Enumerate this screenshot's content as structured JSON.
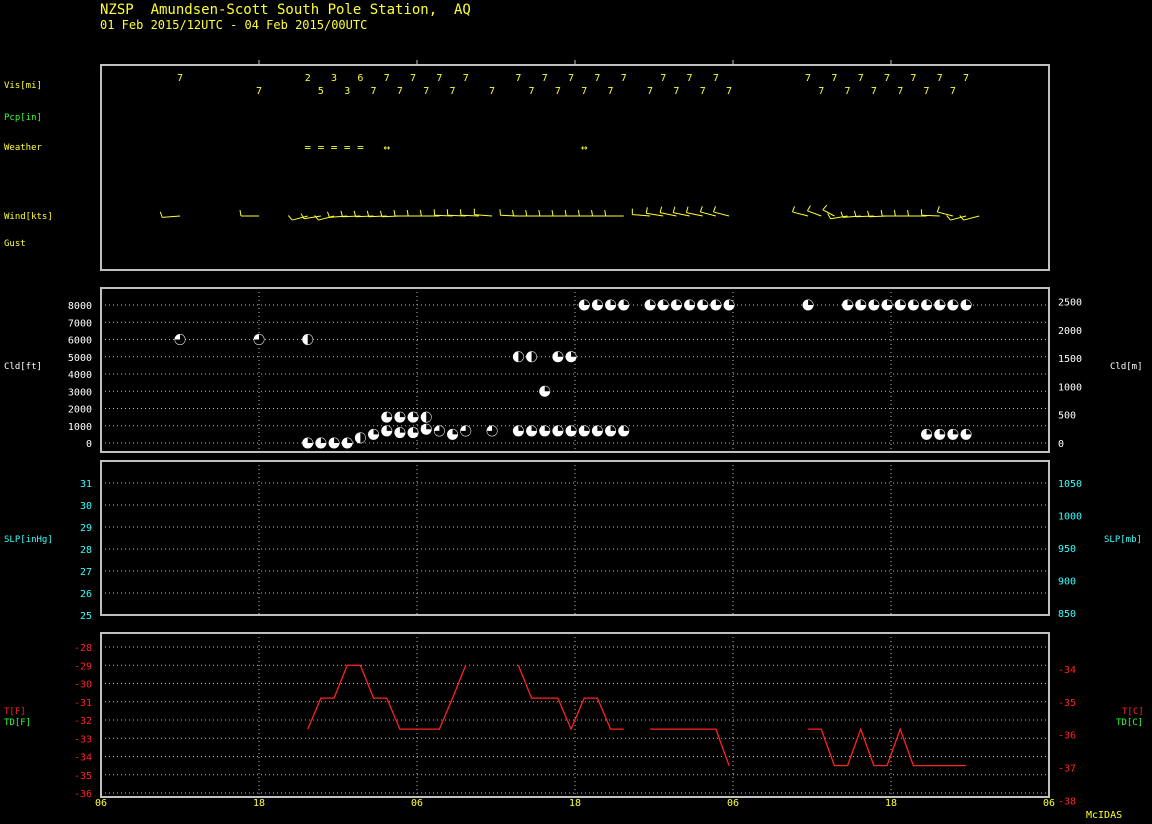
{
  "header": {
    "station_line": "NZSP  Amundsen-Scott South Pole Station,  AQ",
    "period_line": "01 Feb 2015/12UTC - 04 Feb 2015/00UTC"
  },
  "footer": {
    "credit": "McIDAS"
  },
  "colors": {
    "frame": "#c0c0c0",
    "yellow": "#ffff33",
    "green": "#33ff33",
    "cyan": "#33ffff",
    "red": "#ff2222",
    "white": "#ffffff",
    "grid": "#b8b8b8"
  },
  "time_axis": {
    "start_hours": 0,
    "end_hours": 72,
    "tick_hours": [
      0,
      12,
      24,
      36,
      48,
      60,
      72
    ],
    "tick_labels": [
      "06",
      "18",
      "06",
      "18",
      "06",
      "18",
      "06"
    ]
  },
  "weather_panel": {
    "labels": [
      {
        "key": "vis",
        "text": "Vis[mi]",
        "color": "yellow"
      },
      {
        "key": "pcp",
        "text": "Pcp[in]",
        "color": "green"
      },
      {
        "key": "weather",
        "text": "Weather",
        "color": "yellow"
      },
      {
        "key": "wind",
        "text": "Wind[kts]",
        "color": "yellow"
      },
      {
        "key": "gust",
        "text": "Gust",
        "color": "yellow"
      }
    ],
    "visibility": [
      {
        "t": 6,
        "v": "7",
        "row": 0
      },
      {
        "t": 12,
        "v": "7",
        "row": 1
      },
      {
        "t": 15.7,
        "v": "2",
        "row": 0
      },
      {
        "t": 16.7,
        "v": "5",
        "row": 1
      },
      {
        "t": 17.7,
        "v": "3",
        "row": 0
      },
      {
        "t": 18.7,
        "v": "3",
        "row": 1
      },
      {
        "t": 19.7,
        "v": "6",
        "row": 0
      },
      {
        "t": 20.7,
        "v": "7",
        "row": 1
      },
      {
        "t": 21.7,
        "v": "7",
        "row": 0
      },
      {
        "t": 22.7,
        "v": "7",
        "row": 1
      },
      {
        "t": 23.7,
        "v": "7",
        "row": 0
      },
      {
        "t": 24.7,
        "v": "7",
        "row": 1
      },
      {
        "t": 25.7,
        "v": "7",
        "row": 0
      },
      {
        "t": 26.7,
        "v": "7",
        "row": 1
      },
      {
        "t": 27.7,
        "v": "7",
        "row": 0
      },
      {
        "t": 29.7,
        "v": "7",
        "row": 1
      },
      {
        "t": 31.7,
        "v": "7",
        "row": 0
      },
      {
        "t": 32.7,
        "v": "7",
        "row": 1
      },
      {
        "t": 33.7,
        "v": "7",
        "row": 0
      },
      {
        "t": 34.7,
        "v": "7",
        "row": 1
      },
      {
        "t": 35.7,
        "v": "7",
        "row": 0
      },
      {
        "t": 36.7,
        "v": "7",
        "row": 1
      },
      {
        "t": 37.7,
        "v": "7",
        "row": 0
      },
      {
        "t": 38.7,
        "v": "7",
        "row": 1
      },
      {
        "t": 39.7,
        "v": "7",
        "row": 0
      },
      {
        "t": 41.7,
        "v": "7",
        "row": 1
      },
      {
        "t": 42.7,
        "v": "7",
        "row": 0
      },
      {
        "t": 43.7,
        "v": "7",
        "row": 1
      },
      {
        "t": 44.7,
        "v": "7",
        "row": 0
      },
      {
        "t": 45.7,
        "v": "7",
        "row": 1
      },
      {
        "t": 46.7,
        "v": "7",
        "row": 0
      },
      {
        "t": 47.7,
        "v": "7",
        "row": 1
      },
      {
        "t": 53.7,
        "v": "7",
        "row": 0
      },
      {
        "t": 54.7,
        "v": "7",
        "row": 1
      },
      {
        "t": 55.7,
        "v": "7",
        "row": 0
      },
      {
        "t": 56.7,
        "v": "7",
        "row": 1
      },
      {
        "t": 57.7,
        "v": "7",
        "row": 0
      },
      {
        "t": 58.7,
        "v": "7",
        "row": 1
      },
      {
        "t": 59.7,
        "v": "7",
        "row": 0
      },
      {
        "t": 60.7,
        "v": "7",
        "row": 1
      },
      {
        "t": 61.7,
        "v": "7",
        "row": 0
      },
      {
        "t": 62.7,
        "v": "7",
        "row": 1
      },
      {
        "t": 63.7,
        "v": "7",
        "row": 0
      },
      {
        "t": 64.7,
        "v": "7",
        "row": 1
      },
      {
        "t": 65.7,
        "v": "7",
        "row": 0
      }
    ],
    "weather_symbols": [
      {
        "t": 15.7,
        "sym": "="
      },
      {
        "t": 16.7,
        "sym": "="
      },
      {
        "t": 17.7,
        "sym": "="
      },
      {
        "t": 18.7,
        "sym": "="
      },
      {
        "t": 19.7,
        "sym": "="
      },
      {
        "t": 21.7,
        "sym": "↔"
      },
      {
        "t": 36.7,
        "sym": "↔"
      }
    ],
    "wind_barbs": [
      {
        "t": 6,
        "dir": 260,
        "barbs": 1
      },
      {
        "t": 12,
        "dir": 270,
        "barbs": 1
      },
      {
        "t": 15.7,
        "dir": 240,
        "barbs": 1
      },
      {
        "t": 16.7,
        "dir": 250,
        "barbs": 1
      },
      {
        "t": 17.7,
        "dir": 240,
        "barbs": 1
      },
      {
        "t": 18.7,
        "dir": 260,
        "barbs": 1
      },
      {
        "t": 19.7,
        "dir": 265,
        "barbs": 1
      },
      {
        "t": 20.7,
        "dir": 265,
        "barbs": 1
      },
      {
        "t": 21.7,
        "dir": 265,
        "barbs": 1
      },
      {
        "t": 22.7,
        "dir": 265,
        "barbs": 1
      },
      {
        "t": 23.7,
        "dir": 270,
        "barbs": 1
      },
      {
        "t": 24.7,
        "dir": 270,
        "barbs": 1
      },
      {
        "t": 25.7,
        "dir": 270,
        "barbs": 1
      },
      {
        "t": 26.7,
        "dir": 275,
        "barbs": 1
      },
      {
        "t": 27.7,
        "dir": 275,
        "barbs": 1
      },
      {
        "t": 28.7,
        "dir": 275,
        "barbs": 1
      },
      {
        "t": 29.7,
        "dir": 280,
        "barbs": 1
      },
      {
        "t": 31.7,
        "dir": 275,
        "barbs": 1
      },
      {
        "t": 32.7,
        "dir": 270,
        "barbs": 1
      },
      {
        "t": 33.7,
        "dir": 270,
        "barbs": 1
      },
      {
        "t": 34.7,
        "dir": 270,
        "barbs": 1
      },
      {
        "t": 35.7,
        "dir": 270,
        "barbs": 1
      },
      {
        "t": 36.7,
        "dir": 270,
        "barbs": 1
      },
      {
        "t": 37.7,
        "dir": 270,
        "barbs": 1
      },
      {
        "t": 38.7,
        "dir": 270,
        "barbs": 1
      },
      {
        "t": 39.7,
        "dir": 270,
        "barbs": 1
      },
      {
        "t": 41.7,
        "dir": 280,
        "barbs": 1
      },
      {
        "t": 42.7,
        "dir": 290,
        "barbs": 1
      },
      {
        "t": 43.7,
        "dir": 295,
        "barbs": 1
      },
      {
        "t": 44.7,
        "dir": 295,
        "barbs": 1
      },
      {
        "t": 45.7,
        "dir": 295,
        "barbs": 1
      },
      {
        "t": 46.7,
        "dir": 300,
        "barbs": 1
      },
      {
        "t": 47.7,
        "dir": 300,
        "barbs": 1
      },
      {
        "t": 53.7,
        "dir": 300,
        "barbs": 1
      },
      {
        "t": 54.7,
        "dir": 310,
        "barbs": 1
      },
      {
        "t": 55.7,
        "dir": 320,
        "barbs": 1
      },
      {
        "t": 56.7,
        "dir": 250,
        "barbs": 1
      },
      {
        "t": 57.7,
        "dir": 260,
        "barbs": 1
      },
      {
        "t": 58.7,
        "dir": 265,
        "barbs": 1
      },
      {
        "t": 59.7,
        "dir": 265,
        "barbs": 1
      },
      {
        "t": 60.7,
        "dir": 270,
        "barbs": 1
      },
      {
        "t": 61.7,
        "dir": 270,
        "barbs": 1
      },
      {
        "t": 62.7,
        "dir": 270,
        "barbs": 1
      },
      {
        "t": 63.7,
        "dir": 275,
        "barbs": 1
      },
      {
        "t": 64.7,
        "dir": 300,
        "barbs": 1
      },
      {
        "t": 65.7,
        "dir": 240,
        "barbs": 1
      },
      {
        "t": 66.7,
        "dir": 240,
        "barbs": 1
      }
    ]
  },
  "chart_data": [
    {
      "type": "scatter",
      "panel": "cloud",
      "ylabel_left": "Cld[ft]",
      "ylabel_right": "Cld[m]",
      "ylim": [
        0,
        8500
      ],
      "left_ticks": [
        0,
        1000,
        2000,
        3000,
        4000,
        5000,
        6000,
        7000,
        8000
      ],
      "right_ticks_m": [
        0,
        500,
        1000,
        1500,
        2000,
        2500
      ],
      "points": [
        {
          "t": 6,
          "ft": 6000,
          "cover": "bkn"
        },
        {
          "t": 12,
          "ft": 6000,
          "cover": "bkn"
        },
        {
          "t": 15.7,
          "ft": 6000,
          "cover": "sct"
        },
        {
          "t": 15.7,
          "ft": 0,
          "cover": "few"
        },
        {
          "t": 16.7,
          "ft": 0,
          "cover": "few"
        },
        {
          "t": 17.7,
          "ft": 0,
          "cover": "few"
        },
        {
          "t": 18.7,
          "ft": 0,
          "cover": "few"
        },
        {
          "t": 19.7,
          "ft": 300,
          "cover": "sct"
        },
        {
          "t": 20.7,
          "ft": 500,
          "cover": "few"
        },
        {
          "t": 21.7,
          "ft": 700,
          "cover": "few"
        },
        {
          "t": 21.7,
          "ft": 1500,
          "cover": "few"
        },
        {
          "t": 22.7,
          "ft": 1500,
          "cover": "few"
        },
        {
          "t": 23.7,
          "ft": 1500,
          "cover": "few"
        },
        {
          "t": 24.7,
          "ft": 1500,
          "cover": "sct"
        },
        {
          "t": 22.7,
          "ft": 600,
          "cover": "few"
        },
        {
          "t": 23.7,
          "ft": 600,
          "cover": "few"
        },
        {
          "t": 24.7,
          "ft": 800,
          "cover": "few"
        },
        {
          "t": 25.7,
          "ft": 700,
          "cover": "bkn"
        },
        {
          "t": 26.7,
          "ft": 500,
          "cover": "few"
        },
        {
          "t": 27.7,
          "ft": 700,
          "cover": "bkn"
        },
        {
          "t": 29.7,
          "ft": 700,
          "cover": "bkn"
        },
        {
          "t": 31.7,
          "ft": 700,
          "cover": "few"
        },
        {
          "t": 32.7,
          "ft": 700,
          "cover": "few"
        },
        {
          "t": 33.7,
          "ft": 700,
          "cover": "few"
        },
        {
          "t": 34.7,
          "ft": 700,
          "cover": "few"
        },
        {
          "t": 35.7,
          "ft": 700,
          "cover": "few"
        },
        {
          "t": 36.7,
          "ft": 700,
          "cover": "few"
        },
        {
          "t": 37.7,
          "ft": 700,
          "cover": "few"
        },
        {
          "t": 38.7,
          "ft": 700,
          "cover": "few"
        },
        {
          "t": 39.7,
          "ft": 700,
          "cover": "few"
        },
        {
          "t": 31.7,
          "ft": 5000,
          "cover": "sct"
        },
        {
          "t": 32.7,
          "ft": 5000,
          "cover": "sct"
        },
        {
          "t": 34.7,
          "ft": 5000,
          "cover": "few"
        },
        {
          "t": 35.7,
          "ft": 5000,
          "cover": "few"
        },
        {
          "t": 33.7,
          "ft": 3000,
          "cover": "few"
        },
        {
          "t": 36.7,
          "ft": 8000,
          "cover": "few"
        },
        {
          "t": 37.7,
          "ft": 8000,
          "cover": "few"
        },
        {
          "t": 38.7,
          "ft": 8000,
          "cover": "few"
        },
        {
          "t": 39.7,
          "ft": 8000,
          "cover": "few"
        },
        {
          "t": 41.7,
          "ft": 8000,
          "cover": "few"
        },
        {
          "t": 42.7,
          "ft": 8000,
          "cover": "few"
        },
        {
          "t": 43.7,
          "ft": 8000,
          "cover": "few"
        },
        {
          "t": 44.7,
          "ft": 8000,
          "cover": "few"
        },
        {
          "t": 45.7,
          "ft": 8000,
          "cover": "few"
        },
        {
          "t": 46.7,
          "ft": 8000,
          "cover": "few"
        },
        {
          "t": 47.7,
          "ft": 8000,
          "cover": "few"
        },
        {
          "t": 53.7,
          "ft": 8000,
          "cover": "few"
        },
        {
          "t": 56.7,
          "ft": 8000,
          "cover": "few"
        },
        {
          "t": 57.7,
          "ft": 8000,
          "cover": "few"
        },
        {
          "t": 58.7,
          "ft": 8000,
          "cover": "few"
        },
        {
          "t": 59.7,
          "ft": 8000,
          "cover": "few"
        },
        {
          "t": 60.7,
          "ft": 8000,
          "cover": "few"
        },
        {
          "t": 61.7,
          "ft": 8000,
          "cover": "few"
        },
        {
          "t": 62.7,
          "ft": 8000,
          "cover": "few"
        },
        {
          "t": 63.7,
          "ft": 8000,
          "cover": "few"
        },
        {
          "t": 64.7,
          "ft": 8000,
          "cover": "few"
        },
        {
          "t": 65.7,
          "ft": 8000,
          "cover": "few"
        },
        {
          "t": 62.7,
          "ft": 500,
          "cover": "few"
        },
        {
          "t": 63.7,
          "ft": 500,
          "cover": "few"
        },
        {
          "t": 64.7,
          "ft": 500,
          "cover": "few"
        },
        {
          "t": 65.7,
          "ft": 500,
          "cover": "few"
        }
      ]
    },
    {
      "type": "line",
      "panel": "pressure",
      "ylabel_left": "SLP[inHg]",
      "ylabel_right": "SLP[mb]",
      "ylim": [
        25,
        31.5
      ],
      "left_ticks": [
        25,
        26,
        27,
        28,
        29,
        30,
        31
      ],
      "right_ticks_mb": [
        850,
        900,
        950,
        1000,
        1050
      ],
      "series": []
    },
    {
      "type": "line",
      "panel": "temperature",
      "ylabel_left_t": "T[F]",
      "ylabel_left_td": "TD[F]",
      "ylabel_right_t": "T[C]",
      "ylabel_right_td": "TD[C]",
      "ylim": [
        -36,
        -27.5
      ],
      "left_ticks": [
        -36,
        -35,
        -34,
        -33,
        -32,
        -31,
        -30,
        -29,
        -28
      ],
      "right_ticks_c": [
        -38,
        -37,
        -36,
        -35,
        -34
      ],
      "series": [
        {
          "segment": [
            [
              15.7,
              -32.5
            ],
            [
              16.7,
              -30.8
            ],
            [
              17.7,
              -30.8
            ],
            [
              18.7,
              -29
            ],
            [
              19.7,
              -29
            ],
            [
              20.7,
              -30.8
            ],
            [
              21.7,
              -30.8
            ],
            [
              22.7,
              -32.5
            ],
            [
              23.7,
              -32.5
            ],
            [
              24.7,
              -32.5
            ],
            [
              25.7,
              -32.5
            ],
            [
              26.7,
              -30.8
            ],
            [
              27.7,
              -29
            ]
          ]
        },
        {
          "segment": [
            [
              31.7,
              -29
            ],
            [
              32.7,
              -30.8
            ],
            [
              33.7,
              -30.8
            ],
            [
              34.7,
              -30.8
            ],
            [
              35.7,
              -32.5
            ],
            [
              36.7,
              -30.8
            ],
            [
              37.7,
              -30.8
            ],
            [
              38.7,
              -32.5
            ],
            [
              39.7,
              -32.5
            ]
          ]
        },
        {
          "segment": [
            [
              41.7,
              -32.5
            ],
            [
              42.7,
              -32.5
            ],
            [
              43.7,
              -32.5
            ],
            [
              44.7,
              -32.5
            ],
            [
              45.7,
              -32.5
            ],
            [
              46.7,
              -32.5
            ],
            [
              47.7,
              -34.5
            ]
          ]
        },
        {
          "segment": [
            [
              53.7,
              -32.5
            ],
            [
              54.7,
              -32.5
            ],
            [
              55.7,
              -34.5
            ],
            [
              56.7,
              -34.5
            ],
            [
              57.7,
              -32.5
            ],
            [
              58.7,
              -34.5
            ],
            [
              59.7,
              -34.5
            ],
            [
              60.7,
              -32.5
            ],
            [
              61.7,
              -34.5
            ],
            [
              62.7,
              -34.5
            ],
            [
              63.7,
              -34.5
            ],
            [
              64.7,
              -34.5
            ],
            [
              65.7,
              -34.5
            ]
          ]
        }
      ]
    }
  ]
}
